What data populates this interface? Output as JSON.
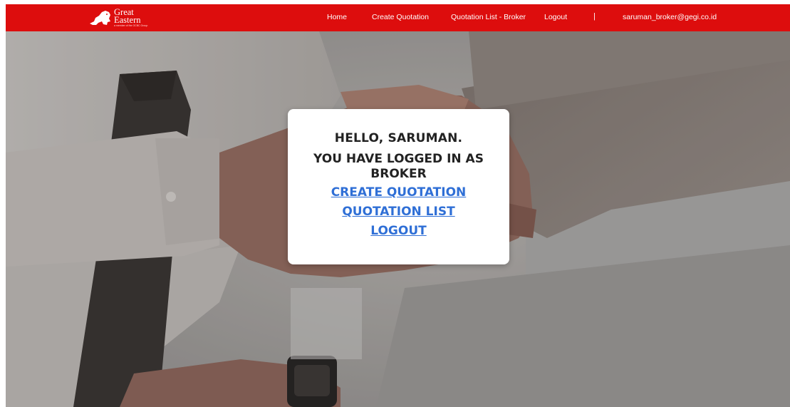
{
  "brand": {
    "line1": "Great",
    "line2": "Eastern",
    "tagline": "a member of the OCBC Group",
    "color": "#dd0d0d"
  },
  "nav": {
    "home": "Home",
    "create_quotation": "Create Quotation",
    "quotation_list": "Quotation List - Broker",
    "logout": "Logout",
    "separator": "|",
    "user_email": "saruman_broker@gegi.co.id"
  },
  "card": {
    "greeting": "HELLO, SARUMAN.",
    "role_message": "YOU HAVE LOGGED IN AS BROKER",
    "link_create": "CREATE QUOTATION",
    "link_list": "QUOTATION LIST",
    "link_logout": "LOGOUT",
    "link_color": "#2f6fd6"
  },
  "background": {
    "description_icon": "handshake-photo"
  }
}
